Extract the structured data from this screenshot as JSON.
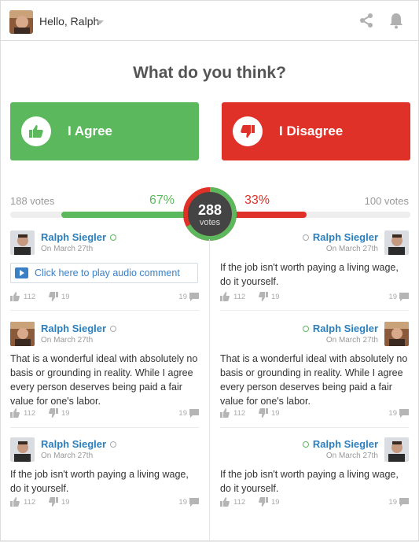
{
  "header": {
    "greeting": "Hello, Ralph"
  },
  "question": "What do you think?",
  "buttons": {
    "agree": "I Agree",
    "disagree": "I Disagree"
  },
  "results": {
    "agree_votes": "188 votes",
    "disagree_votes": "100 votes",
    "agree_pct": "67%",
    "disagree_pct": "33%",
    "agree_fraction": 0.67,
    "total": "288",
    "total_label": "votes"
  },
  "colors": {
    "agree": "#5cb85c",
    "disagree": "#e03128",
    "link": "#2c7fbd",
    "ring_bg": "#444444"
  },
  "comments_left": [
    {
      "name": "Ralph Siegler",
      "date": "On March 27th",
      "audio_label": "Click here to play audio comment",
      "up": "112",
      "down": "19",
      "replies": "19",
      "online": true
    },
    {
      "name": "Ralph Siegler",
      "date": "On March 27th",
      "text": "That is a wonderful ideal with absolutely no basis or grounding in reality. While I agree every person deserves being paid a fair value for one's labor.",
      "up": "112",
      "down": "19",
      "replies": "19",
      "online": false
    },
    {
      "name": "Ralph Siegler",
      "date": "On March 27th",
      "text": "If the job isn't worth paying a living wage, do it yourself.",
      "up": "112",
      "down": "19",
      "replies": "19",
      "online": false
    }
  ],
  "comments_right": [
    {
      "name": "Ralph Siegler",
      "date": "On March 27th",
      "text": "If the job isn't worth paying a living wage, do it yourself.",
      "up": "112",
      "down": "19",
      "replies": "19",
      "online": false
    },
    {
      "name": "Ralph Siegler",
      "date": "On March 27th",
      "text": "That is a wonderful ideal with absolutely no basis or grounding in reality. While I agree every person deserves being paid a fair value for one's labor.",
      "up": "112",
      "down": "19",
      "replies": "19",
      "online": true
    },
    {
      "name": "Ralph Siegler",
      "date": "On March 27th",
      "text": "If the job isn't worth paying a living wage, do it yourself.",
      "up": "112",
      "down": "19",
      "replies": "19",
      "online": true
    }
  ]
}
